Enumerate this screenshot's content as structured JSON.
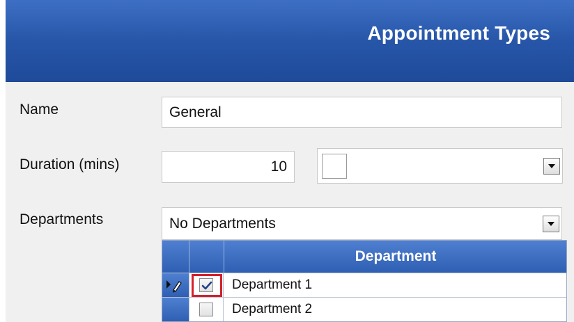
{
  "header": {
    "title": "Appointment Types"
  },
  "form": {
    "name_label": "Name",
    "name_value": "General",
    "duration_label": "Duration (mins)",
    "duration_value": "10",
    "color_swatch": "#ffffff",
    "departments_label": "Departments",
    "departments_value": "No Departments"
  },
  "grid": {
    "column_header": "Department",
    "rows": [
      {
        "label": "Department 1",
        "checked": true,
        "current": true
      },
      {
        "label": "Department 2",
        "checked": false,
        "current": false
      }
    ]
  },
  "colors": {
    "header_blue": "#2756a8",
    "highlight_red": "#d4202a"
  }
}
